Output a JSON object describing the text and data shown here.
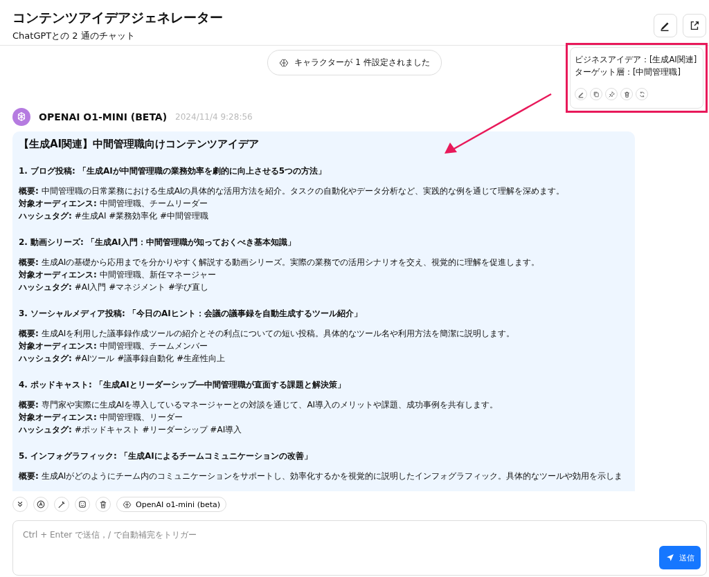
{
  "header": {
    "title": "コンテンツアイデアジェネレーター",
    "subtitle": "ChatGPTとの 2 通のチャット"
  },
  "notice": "キャラクターが 1 件設定されました",
  "note": {
    "lines": [
      "ビジネスアイデア：[生成AI関連]",
      "ターゲット層：[中間管理職]"
    ]
  },
  "message": {
    "sender": "OPENAI O1-MINI (BETA)",
    "time": "2024/11/4 9:28:56",
    "title": "【生成AI関連】中間管理職向けコンテンツアイデア",
    "sections": [
      {
        "heading": "1. ブログ投稿: 「生成AIが中間管理職の業務効率を劇的に向上させる5つの方法」",
        "lines": [
          "**概要:** 中間管理職の日常業務における生成AIの具体的な活用方法を紹介。タスクの自動化やデータ分析など、実践的な例を通じて理解を深めます。",
          "**対象オーディエンス:** 中間管理職、チームリーダー",
          "**ハッシュタグ:** #生成AI #業務効率化 #中間管理職"
        ]
      },
      {
        "heading": "2. 動画シリーズ: 「生成AI入門：中間管理職が知っておくべき基本知識」",
        "lines": [
          "**概要:** 生成AIの基礎から応用までを分かりやすく解説する動画シリーズ。実際の業務での活用シナリオを交え、視覚的に理解を促進します。",
          "**対象オーディエンス:** 中間管理職、新任マネージャー",
          "**ハッシュタグ:** #AI入門 #マネジメント #学び直し"
        ]
      },
      {
        "heading": "3. ソーシャルメディア投稿: 「今日のAIヒント：会議の議事録を自動生成するツール紹介」",
        "lines": [
          "**概要:** 生成AIを利用した議事録作成ツールの紹介とその利点についての短い投稿。具体的なツール名や利用方法を簡潔に説明します。",
          "**対象オーディエンス:** 中間管理職、チームメンバー",
          "**ハッシュタグ:** #AIツール #議事録自動化 #生産性向上"
        ]
      },
      {
        "heading": "4. ポッドキャスト: 「生成AIとリーダーシップ―中間管理職が直面する課題と解決策」",
        "lines": [
          "**概要:** 専門家や実際に生成AIを導入しているマネージャーとの対談を通じて、AI導入のメリットや課題、成功事例を共有します。",
          "**対象オーディエンス:** 中間管理職、リーダー",
          "**ハッシュタグ:** #ポッドキャスト #リーダーシップ #AI導入"
        ]
      },
      {
        "heading": "5. インフォグラフィック: 「生成AIによるチームコミュニケーションの改善」",
        "lines": [
          "**概要:** 生成AIがどのようにチーム内のコミュニケーションをサポートし、効率化するかを視覚的に説明したインフォグラフィック。具体的なツールや効用を示しま"
        ]
      }
    ]
  },
  "toolbar": {
    "model": "OpenAI o1-mini (beta)"
  },
  "composer": {
    "placeholder": "Ctrl + Enter で送信，/ で自動補完をトリガー",
    "send": "送信"
  }
}
